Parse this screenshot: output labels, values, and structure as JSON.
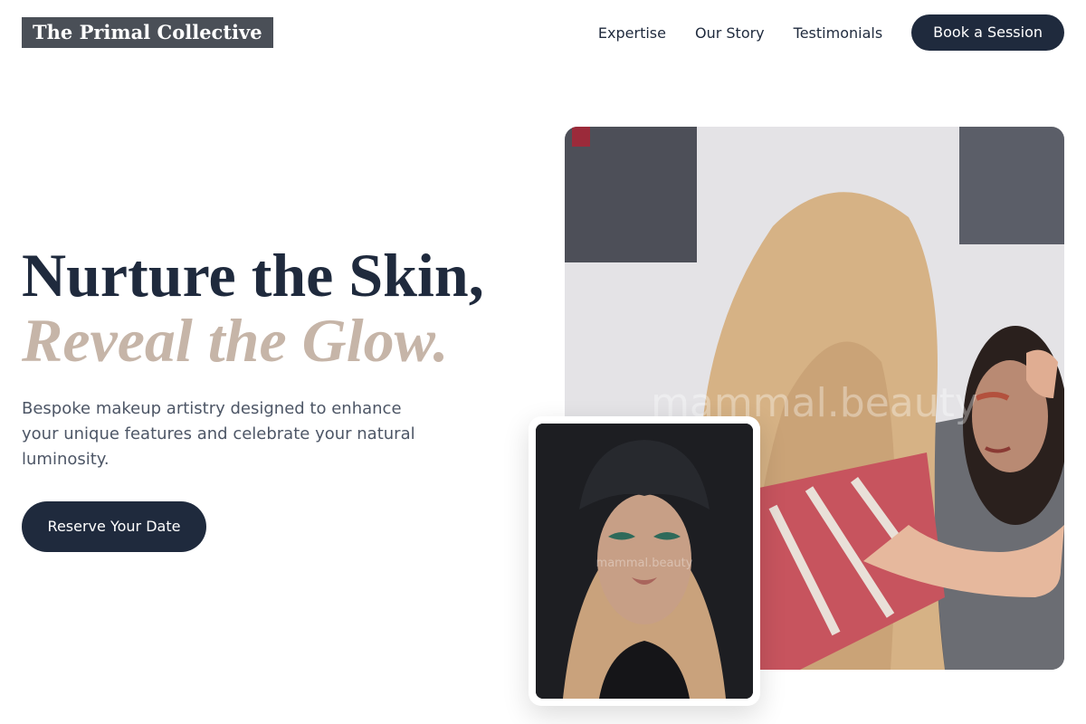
{
  "header": {
    "logo": "The Primal Collective",
    "nav": [
      "Expertise",
      "Our Story",
      "Testimonials"
    ],
    "cta_label": "Book a Session"
  },
  "hero": {
    "title_line1": "Nurture the Skin,",
    "title_line2": "Reveal the Glow.",
    "description": "Bespoke makeup artistry designed to enhance your unique features and celebrate your natural luminosity.",
    "cta_label": "Reserve Your Date"
  },
  "images": {
    "main_photo_icon": "makeup-artist-photo",
    "inset_photo_icon": "model-portrait-photo",
    "watermark": "mammal.beauty"
  },
  "colors": {
    "primary": "#1f2a3d",
    "accent": "#c6b5a8",
    "logo_bg": "#4a4f57"
  }
}
